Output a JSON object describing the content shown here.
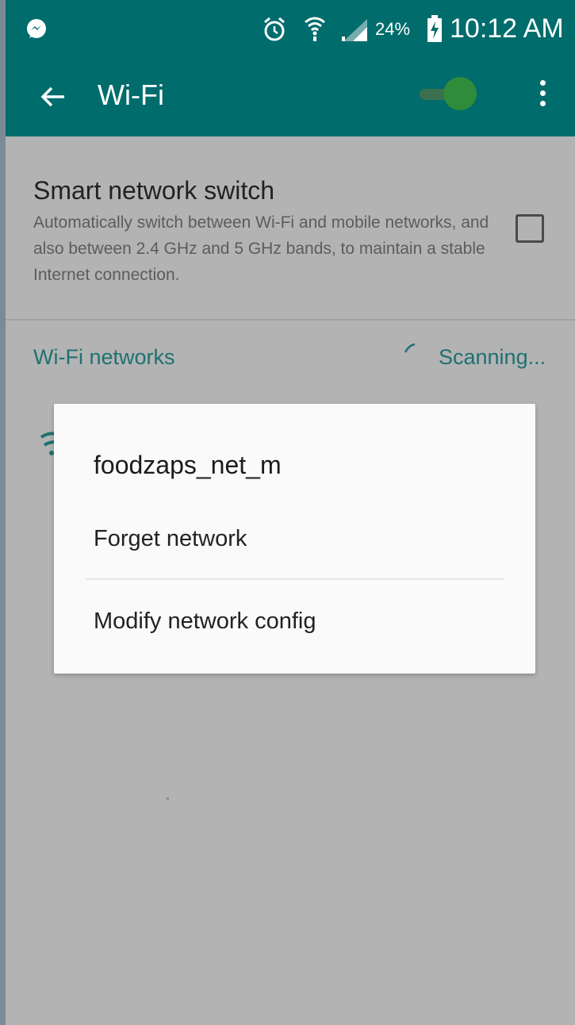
{
  "status_bar": {
    "notification_icon": "messenger-icon",
    "alarm_icon": "alarm-clock-icon",
    "wifi_icon": "wifi-signal-icon",
    "cell_icon": "cell-signal-icon",
    "battery_percent": "24%",
    "battery_icon": "battery-charging-icon",
    "time": "10:12 AM"
  },
  "app_bar": {
    "back_icon": "arrow-left-icon",
    "title": "Wi-Fi",
    "wifi_toggle_on": true,
    "more_icon": "more-vertical-icon"
  },
  "smart_network_switch": {
    "title": "Smart network switch",
    "description": "Automatically switch between Wi-Fi and mobile networks, and also between 2.4 GHz and 5 GHz bands, to maintain a stable Internet connection.",
    "checked": false
  },
  "networks_section": {
    "header": "Wi-Fi networks",
    "status": "Scanning..."
  },
  "dialog": {
    "title": "foodzaps_net_m",
    "options": [
      "Forget network",
      "Modify network config"
    ]
  },
  "colors": {
    "accent": "#006c6c",
    "section_text": "#1f7072",
    "toggle_thumb": "#2f8c3a",
    "scrim_background": "#b3b3b3"
  }
}
